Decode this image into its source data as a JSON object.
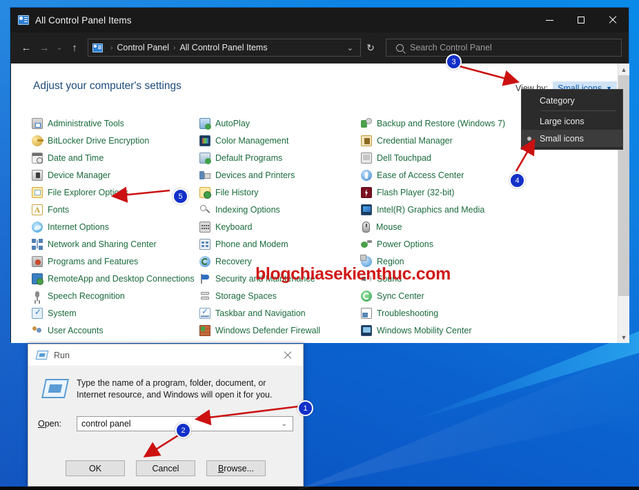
{
  "window": {
    "title": "All Control Panel Items",
    "title_icon": "control-panel-icon",
    "controls": {
      "minimize": "minimize",
      "maximize": "maximize",
      "close": "close"
    }
  },
  "nav": {
    "back": "back-arrow",
    "forward": "forward-arrow",
    "recent": "chevron-down",
    "up": "up-arrow",
    "refresh": "refresh-icon",
    "breadcrumb": [
      "Control Panel",
      "All Control Panel Items"
    ],
    "separator": "›"
  },
  "search": {
    "placeholder": "Search Control Panel",
    "icon": "search-icon"
  },
  "page": {
    "title": "Adjust your computer's settings",
    "view_by_label": "View by:",
    "view_by_value": "Small icons"
  },
  "view_menu": {
    "options": [
      {
        "label": "Category",
        "selected": false
      },
      {
        "label": "Large icons",
        "selected": false
      },
      {
        "label": "Small icons",
        "selected": true
      }
    ]
  },
  "items": {
    "column1": [
      {
        "label": "Administrative Tools",
        "icon": "admin-tools-icon",
        "cls": "ico-admin"
      },
      {
        "label": "BitLocker Drive Encryption",
        "icon": "bitlocker-icon",
        "cls": "ico-key"
      },
      {
        "label": "Date and Time",
        "icon": "date-time-icon",
        "cls": "ico-cal"
      },
      {
        "label": "Device Manager",
        "icon": "device-manager-icon",
        "cls": "ico-dev"
      },
      {
        "label": "File Explorer Options",
        "icon": "file-explorer-options-icon",
        "cls": "ico-folderopt"
      },
      {
        "label": "Fonts",
        "icon": "fonts-icon",
        "cls": "ico-fonts"
      },
      {
        "label": "Internet Options",
        "icon": "internet-options-icon",
        "cls": "ico-ie"
      },
      {
        "label": "Network and Sharing Center",
        "icon": "network-sharing-icon",
        "cls": "ico-net"
      },
      {
        "label": "Programs and Features",
        "icon": "programs-features-icon",
        "cls": "ico-progs"
      },
      {
        "label": "RemoteApp and Desktop Connections",
        "icon": "remoteapp-icon",
        "cls": "ico-remote"
      },
      {
        "label": "Speech Recognition",
        "icon": "speech-recognition-icon",
        "cls": "ico-speech"
      },
      {
        "label": "System",
        "icon": "system-icon",
        "cls": "ico-system"
      },
      {
        "label": "User Accounts",
        "icon": "user-accounts-icon",
        "cls": "ico-users"
      }
    ],
    "column2": [
      {
        "label": "AutoPlay",
        "icon": "autoplay-icon",
        "cls": "ico-autoplay"
      },
      {
        "label": "Color Management",
        "icon": "color-management-icon",
        "cls": "ico-color"
      },
      {
        "label": "Default Programs",
        "icon": "default-programs-icon",
        "cls": "ico-defprog"
      },
      {
        "label": "Devices and Printers",
        "icon": "devices-printers-icon",
        "cls": "ico-printers"
      },
      {
        "label": "File History",
        "icon": "file-history-icon",
        "cls": "ico-filehist"
      },
      {
        "label": "Indexing Options",
        "icon": "indexing-options-icon",
        "cls": "ico-index"
      },
      {
        "label": "Keyboard",
        "icon": "keyboard-icon",
        "cls": "ico-keyb"
      },
      {
        "label": "Phone and Modem",
        "icon": "phone-modem-icon",
        "cls": "ico-phone"
      },
      {
        "label": "Recovery",
        "icon": "recovery-icon",
        "cls": "ico-recovery"
      },
      {
        "label": "Security and Maintenance",
        "icon": "security-maintenance-icon",
        "cls": "ico-flag"
      },
      {
        "label": "Storage Spaces",
        "icon": "storage-spaces-icon",
        "cls": "ico-storage"
      },
      {
        "label": "Taskbar and Navigation",
        "icon": "taskbar-navigation-icon",
        "cls": "ico-taskbar"
      },
      {
        "label": "Windows Defender Firewall",
        "icon": "windows-defender-firewall-icon",
        "cls": "ico-firewall"
      }
    ],
    "column3": [
      {
        "label": "Backup and Restore (Windows 7)",
        "icon": "backup-restore-icon",
        "cls": "ico-backup"
      },
      {
        "label": "Credential Manager",
        "icon": "credential-manager-icon",
        "cls": "ico-cred"
      },
      {
        "label": "Dell Touchpad",
        "icon": "dell-touchpad-icon",
        "cls": "ico-touchpad"
      },
      {
        "label": "Ease of Access Center",
        "icon": "ease-of-access-icon",
        "cls": "ico-ease"
      },
      {
        "label": "Flash Player (32-bit)",
        "icon": "flash-player-icon",
        "cls": "ico-flash"
      },
      {
        "label": "Intel(R) Graphics and Media",
        "icon": "intel-graphics-icon",
        "cls": "ico-intel"
      },
      {
        "label": "Mouse",
        "icon": "mouse-icon",
        "cls": "ico-mouse"
      },
      {
        "label": "Power Options",
        "icon": "power-options-icon",
        "cls": "ico-power"
      },
      {
        "label": "Region",
        "icon": "region-icon",
        "cls": "ico-region"
      },
      {
        "label": "Sound",
        "icon": "sound-icon",
        "cls": "ico-sound"
      },
      {
        "label": "Sync Center",
        "icon": "sync-center-icon",
        "cls": "ico-sync"
      },
      {
        "label": "Troubleshooting",
        "icon": "troubleshooting-icon",
        "cls": "ico-trouble"
      },
      {
        "label": "Windows Mobility Center",
        "icon": "windows-mobility-icon",
        "cls": "ico-mobility"
      }
    ]
  },
  "run_dialog": {
    "title": "Run",
    "icon": "run-icon",
    "close": "close",
    "description": "Type the name of a program, folder, document, or Internet resource, and Windows will open it for you.",
    "open_label": "Open:",
    "open_value": "control panel",
    "buttons": {
      "ok": "OK",
      "cancel": "Cancel",
      "browse": "Browse..."
    }
  },
  "annotations": {
    "markers": [
      "1",
      "2",
      "3",
      "4",
      "5"
    ],
    "watermark": "blogchiasekienthuc.com",
    "arrow_color": "#cc1111"
  }
}
